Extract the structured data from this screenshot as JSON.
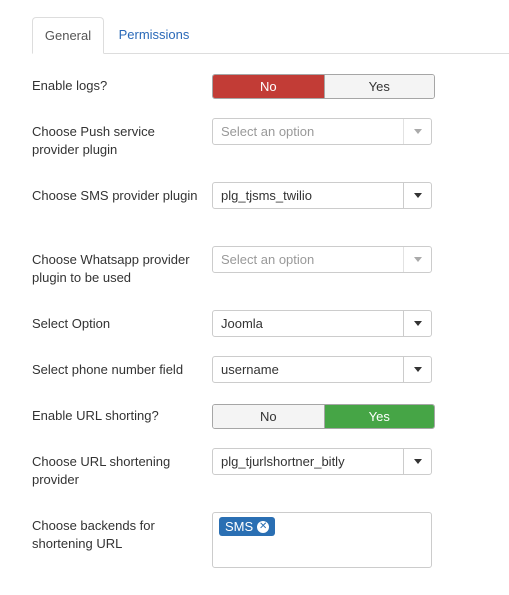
{
  "tabs": [
    {
      "label": "General",
      "active": true
    },
    {
      "label": "Permissions",
      "active": false
    }
  ],
  "fields": {
    "enable_logs": {
      "label": "Enable logs?",
      "options": [
        "No",
        "Yes"
      ],
      "selected": "No"
    },
    "push_provider": {
      "label": "Choose Push service provider plugin",
      "placeholder": "Select an option",
      "value": ""
    },
    "sms_provider": {
      "label": "Choose SMS provider plugin",
      "value": "plg_tjsms_twilio"
    },
    "whatsapp_provider": {
      "label": "Choose Whatsapp provider plugin to be used",
      "placeholder": "Select an option",
      "value": ""
    },
    "select_option": {
      "label": "Select Option",
      "value": "Joomla"
    },
    "phone_field": {
      "label": "Select phone number field",
      "value": "username"
    },
    "url_shorting": {
      "label": "Enable URL shorting?",
      "options": [
        "No",
        "Yes"
      ],
      "selected": "Yes"
    },
    "url_shortener": {
      "label": "Choose URL shortening provider",
      "value": "plg_tjurlshortner_bitly"
    },
    "backends": {
      "label": "Choose backends for shortening URL",
      "tags": [
        "SMS"
      ]
    }
  },
  "colors": {
    "no_active": "#c23c36",
    "yes_active": "#46a546",
    "tag": "#2a6fb3",
    "link": "#2a69b8"
  }
}
